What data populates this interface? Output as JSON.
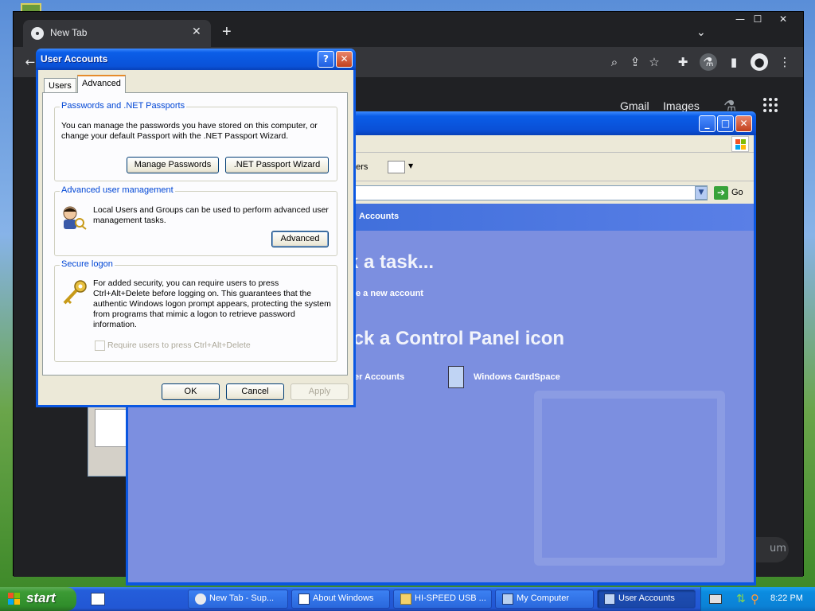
{
  "chrome": {
    "tab_title": "New Tab",
    "tab_close": "✕",
    "new_tab": "+",
    "tab_search": "⌄",
    "win_min": "—",
    "win_max": "☐",
    "win_close": "✕",
    "toolbar_icons": [
      "zoom-icon",
      "share-icon",
      "bookmark-star-icon",
      "extensions-icon",
      "labs-icon",
      "side-panel-icon",
      "profile-icon",
      "menu-icon"
    ],
    "gmail": "Gmail",
    "images": "Images",
    "customize": "um"
  },
  "control_panel": {
    "folders_label": "ders",
    "go_label": "Go",
    "crumb": "Accounts",
    "pick_task": "k a task...",
    "create_account": "e a new account",
    "pick_icon": "ick a Control Panel icon",
    "ua_link": "er Accounts",
    "cardspace": "Windows CardSpace"
  },
  "dialog": {
    "title": "User Accounts",
    "help": "?",
    "close": "✕",
    "tabs": [
      "Users",
      "Advanced"
    ],
    "passwords": {
      "label": "Passwords and .NET Passports",
      "text": "You can manage the passwords you have stored on this computer, or change your default Passport with the .NET Passport Wizard.",
      "manage_btn": "Manage Passwords",
      "wizard_btn": ".NET Passport Wizard"
    },
    "advanced_mgmt": {
      "label": "Advanced user management",
      "text": "Local Users and Groups can be used to perform advanced user management tasks.",
      "advanced_btn": "Advanced"
    },
    "secure_logon": {
      "label": "Secure logon",
      "text": "For added security, you can require users to press Ctrl+Alt+Delete before logging on. This guarantees that the authentic Windows logon prompt appears, protecting the system from programs that mimic a logon to retrieve password information.",
      "checkbox_label": "Require users to press Ctrl+Alt+Delete",
      "checked": false
    },
    "ok": "OK",
    "cancel": "Cancel",
    "apply": "Apply"
  },
  "taskbar": {
    "start": "start",
    "tasks": [
      {
        "label": "New Tab - Sup...",
        "active": false
      },
      {
        "label": "About Windows",
        "active": false
      },
      {
        "label": "HI-SPEED USB ...",
        "active": false
      },
      {
        "label": "My Computer",
        "active": false
      },
      {
        "label": "User Accounts",
        "active": true
      }
    ],
    "clock": "8:22 PM"
  }
}
